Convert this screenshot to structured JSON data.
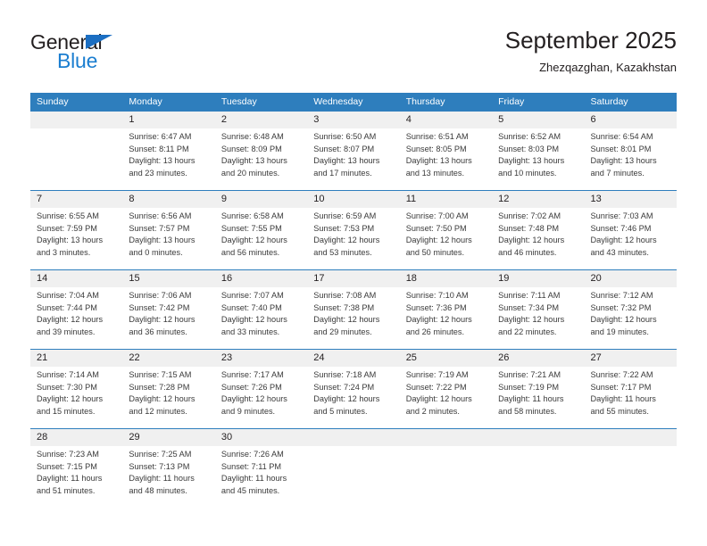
{
  "brand": {
    "name_part1": "General",
    "name_part2": "Blue",
    "triangle_icon": "triangle-icon",
    "color_dark": "#231f20",
    "color_blue": "#1b7ed0"
  },
  "header": {
    "title": "September 2025",
    "subtitle": "Zhezqazghan, Kazakhstan"
  },
  "theme": {
    "header_blue": "#2e7ebd",
    "daynum_band": "#f0f0f0",
    "text": "#231f20"
  },
  "calendar": {
    "weekday_headers": [
      "Sunday",
      "Monday",
      "Tuesday",
      "Wednesday",
      "Thursday",
      "Friday",
      "Saturday"
    ],
    "weeks": [
      [
        {
          "day": "",
          "lines": [
            "",
            "",
            "",
            ""
          ]
        },
        {
          "day": "1",
          "lines": [
            "Sunrise: 6:47 AM",
            "Sunset: 8:11 PM",
            "Daylight: 13 hours",
            "and 23 minutes."
          ]
        },
        {
          "day": "2",
          "lines": [
            "Sunrise: 6:48 AM",
            "Sunset: 8:09 PM",
            "Daylight: 13 hours",
            "and 20 minutes."
          ]
        },
        {
          "day": "3",
          "lines": [
            "Sunrise: 6:50 AM",
            "Sunset: 8:07 PM",
            "Daylight: 13 hours",
            "and 17 minutes."
          ]
        },
        {
          "day": "4",
          "lines": [
            "Sunrise: 6:51 AM",
            "Sunset: 8:05 PM",
            "Daylight: 13 hours",
            "and 13 minutes."
          ]
        },
        {
          "day": "5",
          "lines": [
            "Sunrise: 6:52 AM",
            "Sunset: 8:03 PM",
            "Daylight: 13 hours",
            "and 10 minutes."
          ]
        },
        {
          "day": "6",
          "lines": [
            "Sunrise: 6:54 AM",
            "Sunset: 8:01 PM",
            "Daylight: 13 hours",
            "and 7 minutes."
          ]
        }
      ],
      [
        {
          "day": "7",
          "lines": [
            "Sunrise: 6:55 AM",
            "Sunset: 7:59 PM",
            "Daylight: 13 hours",
            "and 3 minutes."
          ]
        },
        {
          "day": "8",
          "lines": [
            "Sunrise: 6:56 AM",
            "Sunset: 7:57 PM",
            "Daylight: 13 hours",
            "and 0 minutes."
          ]
        },
        {
          "day": "9",
          "lines": [
            "Sunrise: 6:58 AM",
            "Sunset: 7:55 PM",
            "Daylight: 12 hours",
            "and 56 minutes."
          ]
        },
        {
          "day": "10",
          "lines": [
            "Sunrise: 6:59 AM",
            "Sunset: 7:53 PM",
            "Daylight: 12 hours",
            "and 53 minutes."
          ]
        },
        {
          "day": "11",
          "lines": [
            "Sunrise: 7:00 AM",
            "Sunset: 7:50 PM",
            "Daylight: 12 hours",
            "and 50 minutes."
          ]
        },
        {
          "day": "12",
          "lines": [
            "Sunrise: 7:02 AM",
            "Sunset: 7:48 PM",
            "Daylight: 12 hours",
            "and 46 minutes."
          ]
        },
        {
          "day": "13",
          "lines": [
            "Sunrise: 7:03 AM",
            "Sunset: 7:46 PM",
            "Daylight: 12 hours",
            "and 43 minutes."
          ]
        }
      ],
      [
        {
          "day": "14",
          "lines": [
            "Sunrise: 7:04 AM",
            "Sunset: 7:44 PM",
            "Daylight: 12 hours",
            "and 39 minutes."
          ]
        },
        {
          "day": "15",
          "lines": [
            "Sunrise: 7:06 AM",
            "Sunset: 7:42 PM",
            "Daylight: 12 hours",
            "and 36 minutes."
          ]
        },
        {
          "day": "16",
          "lines": [
            "Sunrise: 7:07 AM",
            "Sunset: 7:40 PM",
            "Daylight: 12 hours",
            "and 33 minutes."
          ]
        },
        {
          "day": "17",
          "lines": [
            "Sunrise: 7:08 AM",
            "Sunset: 7:38 PM",
            "Daylight: 12 hours",
            "and 29 minutes."
          ]
        },
        {
          "day": "18",
          "lines": [
            "Sunrise: 7:10 AM",
            "Sunset: 7:36 PM",
            "Daylight: 12 hours",
            "and 26 minutes."
          ]
        },
        {
          "day": "19",
          "lines": [
            "Sunrise: 7:11 AM",
            "Sunset: 7:34 PM",
            "Daylight: 12 hours",
            "and 22 minutes."
          ]
        },
        {
          "day": "20",
          "lines": [
            "Sunrise: 7:12 AM",
            "Sunset: 7:32 PM",
            "Daylight: 12 hours",
            "and 19 minutes."
          ]
        }
      ],
      [
        {
          "day": "21",
          "lines": [
            "Sunrise: 7:14 AM",
            "Sunset: 7:30 PM",
            "Daylight: 12 hours",
            "and 15 minutes."
          ]
        },
        {
          "day": "22",
          "lines": [
            "Sunrise: 7:15 AM",
            "Sunset: 7:28 PM",
            "Daylight: 12 hours",
            "and 12 minutes."
          ]
        },
        {
          "day": "23",
          "lines": [
            "Sunrise: 7:17 AM",
            "Sunset: 7:26 PM",
            "Daylight: 12 hours",
            "and 9 minutes."
          ]
        },
        {
          "day": "24",
          "lines": [
            "Sunrise: 7:18 AM",
            "Sunset: 7:24 PM",
            "Daylight: 12 hours",
            "and 5 minutes."
          ]
        },
        {
          "day": "25",
          "lines": [
            "Sunrise: 7:19 AM",
            "Sunset: 7:22 PM",
            "Daylight: 12 hours",
            "and 2 minutes."
          ]
        },
        {
          "day": "26",
          "lines": [
            "Sunrise: 7:21 AM",
            "Sunset: 7:19 PM",
            "Daylight: 11 hours",
            "and 58 minutes."
          ]
        },
        {
          "day": "27",
          "lines": [
            "Sunrise: 7:22 AM",
            "Sunset: 7:17 PM",
            "Daylight: 11 hours",
            "and 55 minutes."
          ]
        }
      ],
      [
        {
          "day": "28",
          "lines": [
            "Sunrise: 7:23 AM",
            "Sunset: 7:15 PM",
            "Daylight: 11 hours",
            "and 51 minutes."
          ]
        },
        {
          "day": "29",
          "lines": [
            "Sunrise: 7:25 AM",
            "Sunset: 7:13 PM",
            "Daylight: 11 hours",
            "and 48 minutes."
          ]
        },
        {
          "day": "30",
          "lines": [
            "Sunrise: 7:26 AM",
            "Sunset: 7:11 PM",
            "Daylight: 11 hours",
            "and 45 minutes."
          ]
        },
        {
          "day": "",
          "lines": [
            "",
            "",
            "",
            ""
          ]
        },
        {
          "day": "",
          "lines": [
            "",
            "",
            "",
            ""
          ]
        },
        {
          "day": "",
          "lines": [
            "",
            "",
            "",
            ""
          ]
        },
        {
          "day": "",
          "lines": [
            "",
            "",
            "",
            ""
          ]
        }
      ]
    ]
  }
}
